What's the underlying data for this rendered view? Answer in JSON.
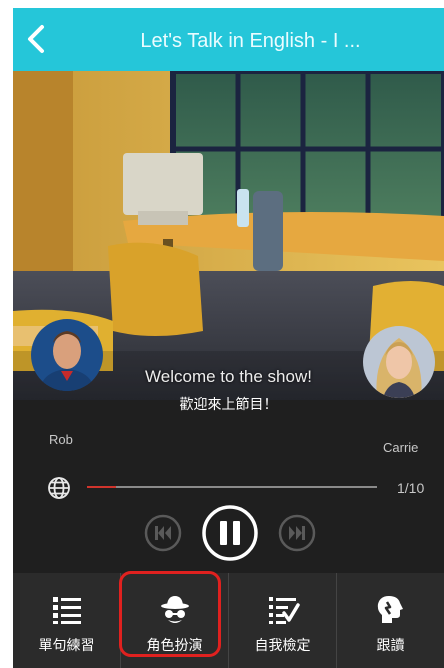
{
  "header": {
    "title": "Let's Talk in English - I ...",
    "back_icon": "chevron-left-icon",
    "color": "#25c6d9"
  },
  "scene": {
    "subtitle_en": "Welcome to the show!",
    "subtitle_zh": "歡迎來上節目！",
    "speakers": [
      {
        "name": "Rob"
      },
      {
        "name": "Carrie"
      }
    ]
  },
  "player": {
    "language_icon": "globe-icon",
    "progress": 0.1,
    "counter": "1/10",
    "controls": [
      "previous-icon",
      "pause-icon",
      "next-icon"
    ],
    "progress_color": "#d0342c"
  },
  "tabs": [
    {
      "label": "單句練習",
      "icon": "list-icon"
    },
    {
      "label": "角色扮演",
      "icon": "incognito-icon"
    },
    {
      "label": "自我檢定",
      "icon": "checklist-icon"
    },
    {
      "label": "跟讀",
      "icon": "speaking-head-icon"
    }
  ],
  "highlight_color": "#e0211f"
}
